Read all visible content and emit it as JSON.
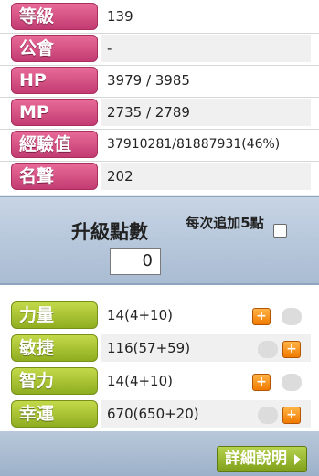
{
  "stats_top": [
    {
      "label": "等級",
      "value": "139"
    },
    {
      "label": "公會",
      "value": "-"
    },
    {
      "label": "HP",
      "value": "3979 / 3985"
    },
    {
      "label": "MP",
      "value": "2735 / 2789"
    },
    {
      "label": "經驗值",
      "value": "37910281/81887931(46%)"
    },
    {
      "label": "名聲",
      "value": "202"
    }
  ],
  "ability": {
    "title": "升級點數",
    "points": "0",
    "auto_label": "每次追加5點"
  },
  "stats_bottom": [
    {
      "label": "力量",
      "value": "14(4+10)"
    },
    {
      "label": "敏捷",
      "value": "116(57+59)"
    },
    {
      "label": "智力",
      "value": "14(4+10)"
    },
    {
      "label": "幸運",
      "value": "670(650+20)"
    }
  ],
  "icons": {
    "plus": "+"
  },
  "footer": {
    "detail_label": "詳細說明"
  }
}
